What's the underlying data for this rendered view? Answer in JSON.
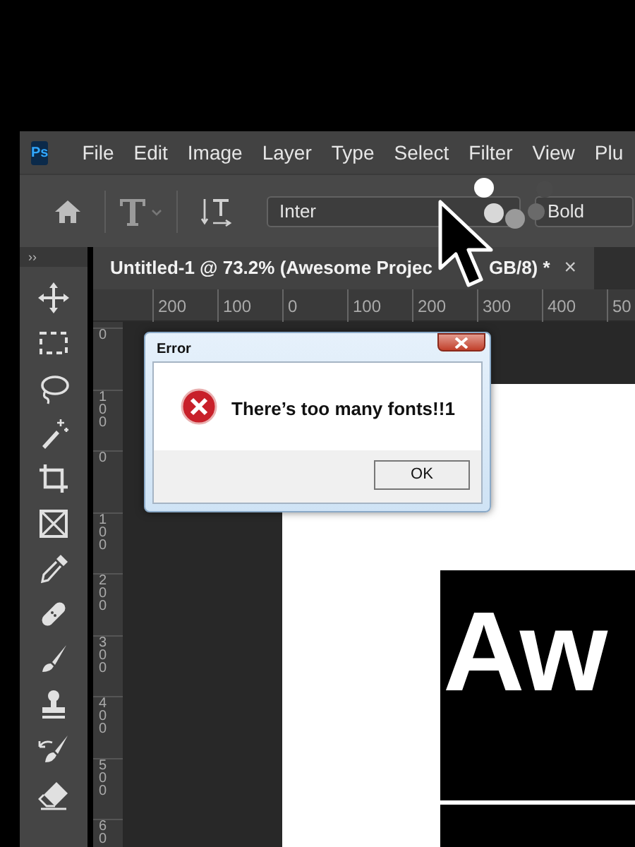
{
  "menu_bar": {
    "logo": "Ps",
    "items": [
      "File",
      "Edit",
      "Image",
      "Layer",
      "Type",
      "Select",
      "Filter",
      "View",
      "Plu"
    ]
  },
  "options_bar": {
    "font_family": "Inter",
    "font_style": "Bold"
  },
  "toolbar": {
    "collapse": "››"
  },
  "document_tab": {
    "title_start": "Untitled-1 @ 73.2% (Awesome Projec",
    "title_end": "GB/8) *",
    "close": "×"
  },
  "rulers": {
    "horizontal": [
      "200",
      "100",
      "0",
      "100",
      "200",
      "300",
      "400",
      "50"
    ],
    "vertical": [
      "0",
      "100",
      "0",
      "100",
      "200",
      "300",
      "400",
      "500",
      "60"
    ]
  },
  "document": {
    "headline": "Aw"
  },
  "dialog": {
    "title": "Error",
    "message": "There’s too many fonts!!1",
    "button": "OK"
  }
}
